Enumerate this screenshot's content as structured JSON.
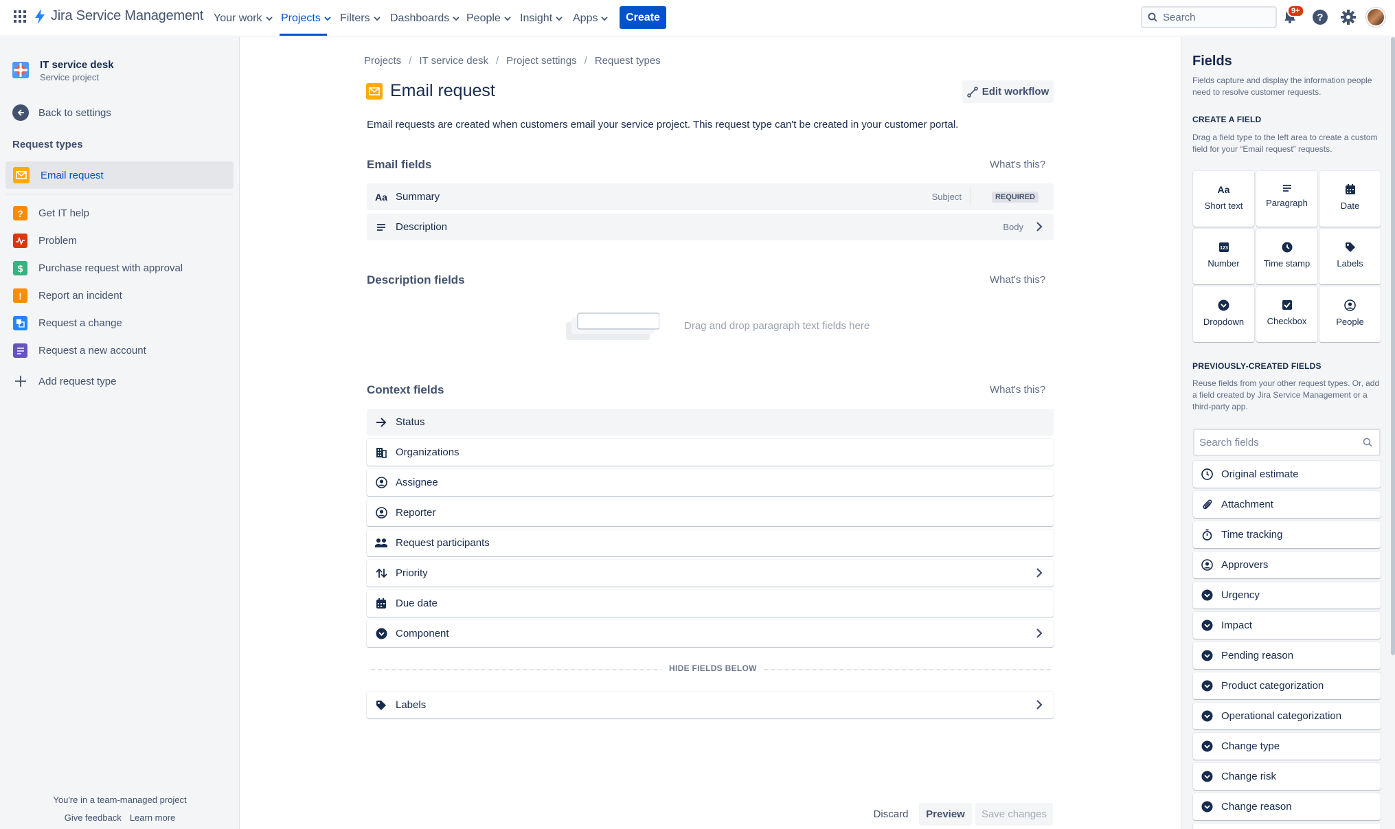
{
  "topnav": {
    "brand": "Jira Service Management",
    "items": [
      "Your work",
      "Projects",
      "Filters",
      "Dashboards",
      "People",
      "Insight",
      "Apps"
    ],
    "create_label": "Create",
    "search_placeholder": "Search",
    "notification_badge": "9+"
  },
  "sidebar": {
    "project_name": "IT service desk",
    "project_type": "Service project",
    "back_label": "Back to settings",
    "request_types_heading": "Request types",
    "selected_item": "Email request",
    "items": [
      {
        "label": "Get IT help",
        "icon": "question-icon",
        "color": "#ff8b00"
      },
      {
        "label": "Problem",
        "icon": "pulse-icon",
        "color": "#de350b"
      },
      {
        "label": "Purchase request with approval",
        "icon": "dollar-icon",
        "color": "#36b37e"
      },
      {
        "label": "Report an incident",
        "icon": "exclamation-icon",
        "color": "#ff8b00"
      },
      {
        "label": "Request a change",
        "icon": "change-icon",
        "color": "#2684ff"
      },
      {
        "label": "Request a new account",
        "icon": "document-icon",
        "color": "#6554c0"
      }
    ],
    "add_label": "Add request type",
    "team_managed": "You're in a team-managed project",
    "feedback": "Give feedback",
    "learn_more": "Learn more"
  },
  "main": {
    "breadcrumb": [
      "Projects",
      "IT service desk",
      "Project settings",
      "Request types"
    ],
    "title": "Email request",
    "edit_workflow": "Edit workflow",
    "description": "Email requests are created when customers email your service project. This request type can't be created in your customer portal.",
    "whats_this": "What's this?",
    "email_fields": {
      "title": "Email fields",
      "summary": "Summary",
      "summary_meta": "Subject",
      "required": "REQUIRED",
      "description": "Description",
      "description_meta": "Body"
    },
    "description_fields": {
      "title": "Description fields",
      "drop_hint": "Drag and drop paragraph text fields here"
    },
    "context_fields": {
      "title": "Context fields",
      "items": [
        "Status",
        "Organizations",
        "Assignee",
        "Reporter",
        "Request participants",
        "Priority",
        "Due date",
        "Component"
      ],
      "hide_label": "HIDE FIELDS BELOW",
      "hidden_items": [
        "Labels"
      ]
    },
    "actions": {
      "discard": "Discard",
      "preview": "Preview",
      "save": "Save changes"
    }
  },
  "panel": {
    "title": "Fields",
    "intro": "Fields capture and display the information people need to resolve customer requests.",
    "create_heading": "CREATE A FIELD",
    "create_text": "Drag a field type to the left area to create a custom field for your “Email request” requests.",
    "field_types": [
      "Short text",
      "Paragraph",
      "Date",
      "Number",
      "Time stamp",
      "Labels",
      "Dropdown",
      "Checkbox",
      "People"
    ],
    "prev_heading": "PREVIOUSLY-CREATED FIELDS",
    "prev_text": "Reuse fields from your other request types. Or, add a field created by Jira Service Management or a third-party app.",
    "search_placeholder": "Search fields",
    "prev_items": [
      "Original estimate",
      "Attachment",
      "Time tracking",
      "Approvers",
      "Urgency",
      "Impact",
      "Pending reason",
      "Product categorization",
      "Operational categorization",
      "Change type",
      "Change risk",
      "Change reason"
    ]
  },
  "colors": {
    "brand": "#0052cc",
    "email_icon": "#ffab00"
  }
}
